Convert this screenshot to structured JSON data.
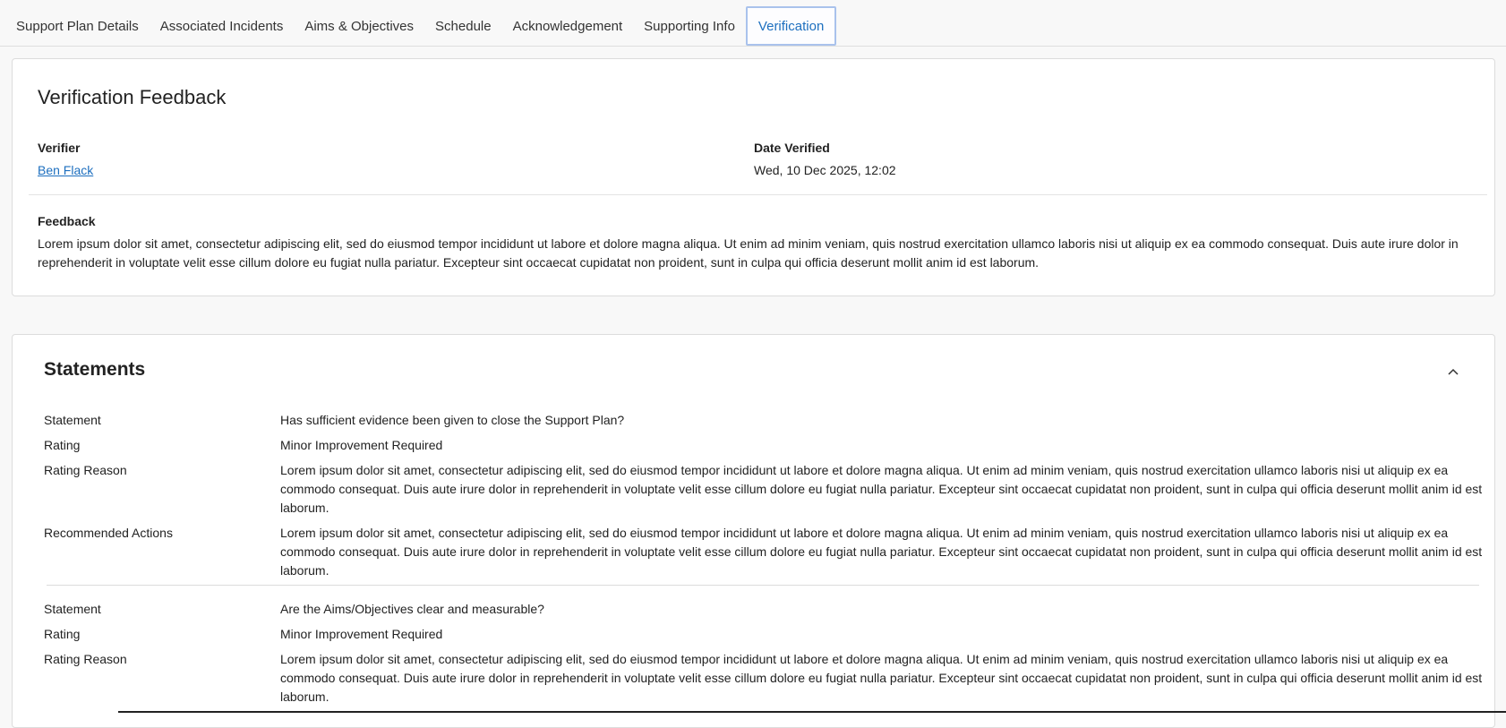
{
  "tabs": [
    {
      "label": "Support Plan Details"
    },
    {
      "label": "Associated Incidents"
    },
    {
      "label": "Aims & Objectives"
    },
    {
      "label": "Schedule"
    },
    {
      "label": "Acknowledgement"
    },
    {
      "label": "Supporting Info"
    },
    {
      "label": "Verification"
    }
  ],
  "verification": {
    "title": "Verification Feedback",
    "verifier_label": "Verifier",
    "verifier_name": "Ben Flack",
    "date_label": "Date Verified",
    "date_value": "Wed, 10 Dec 2025, 12:02",
    "feedback_label": "Feedback",
    "feedback_text": "Lorem ipsum dolor sit amet, consectetur adipiscing elit, sed do eiusmod tempor incididunt ut labore et dolore magna aliqua. Ut enim ad minim veniam, quis nostrud exercitation ullamco laboris nisi ut aliquip ex ea commodo consequat. Duis aute irure dolor in reprehenderit in voluptate velit esse cillum dolore eu fugiat nulla pariatur. Excepteur sint occaecat cupidatat non proident, sunt in culpa qui officia deserunt mollit anim id est laborum."
  },
  "statements": {
    "title": "Statements",
    "labels": {
      "statement": "Statement",
      "rating": "Rating",
      "rating_reason": "Rating Reason",
      "recommended_actions": "Recommended Actions"
    },
    "items": [
      {
        "statement": "Has sufficient evidence been given to close the Support Plan?",
        "rating": "Minor Improvement Required",
        "rating_reason": "Lorem ipsum dolor sit amet, consectetur adipiscing elit, sed do eiusmod tempor incididunt ut labore et dolore magna aliqua. Ut enim ad minim veniam, quis nostrud exercitation ullamco laboris nisi ut aliquip ex ea commodo consequat. Duis aute irure dolor in reprehenderit in voluptate velit esse cillum dolore eu fugiat nulla pariatur. Excepteur sint occaecat cupidatat non proident, sunt in culpa qui officia deserunt mollit anim id est laborum.",
        "recommended_actions": "Lorem ipsum dolor sit amet, consectetur adipiscing elit, sed do eiusmod tempor incididunt ut labore et dolore magna aliqua. Ut enim ad minim veniam, quis nostrud exercitation ullamco laboris nisi ut aliquip ex ea commodo consequat. Duis aute irure dolor in reprehenderit in voluptate velit esse cillum dolore eu fugiat nulla pariatur. Excepteur sint occaecat cupidatat non proident, sunt in culpa qui officia deserunt mollit anim id est laborum."
      },
      {
        "statement": "Are the Aims/Objectives clear and measurable?",
        "rating": "Minor Improvement Required",
        "rating_reason": "Lorem ipsum dolor sit amet, consectetur adipiscing elit, sed do eiusmod tempor incididunt ut labore et dolore magna aliqua. Ut enim ad minim veniam, quis nostrud exercitation ullamco laboris nisi ut aliquip ex ea commodo consequat. Duis aute irure dolor in reprehenderit in voluptate velit esse cillum dolore eu fugiat nulla pariatur. Excepteur sint occaecat cupidatat non proident, sunt in culpa qui officia deserunt mollit anim id est laborum."
      }
    ]
  },
  "colors": {
    "accent": "#1d6fbf",
    "active_tab_border": "#a9c2ec",
    "page_bg": "#f8f8f8",
    "card_border": "#dcdcdc"
  },
  "icons": {
    "collapse": "chevron-up-icon"
  }
}
